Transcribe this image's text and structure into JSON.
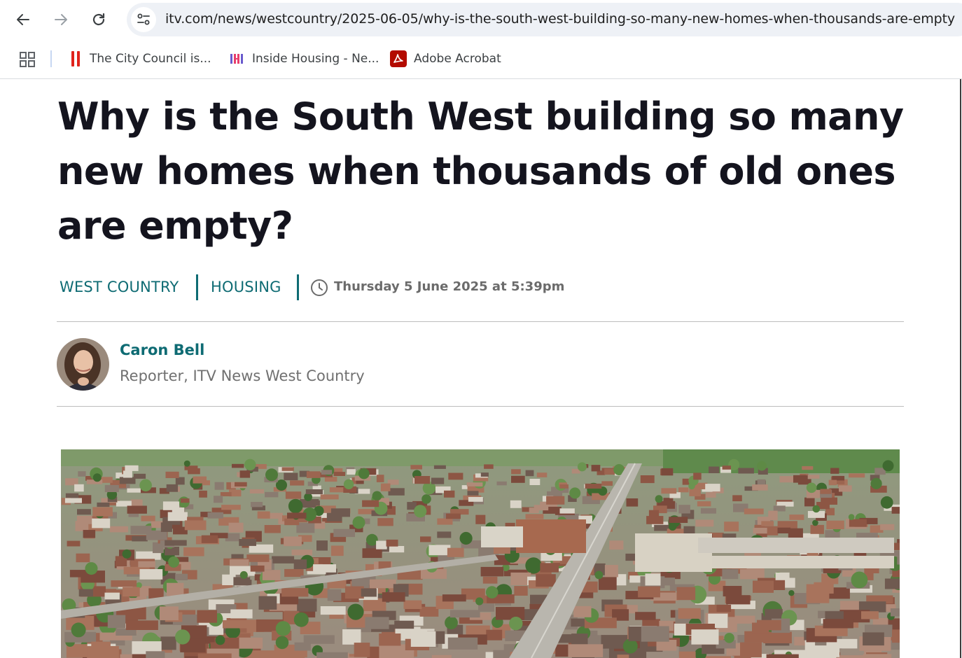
{
  "browser": {
    "url": "itv.com/news/westcountry/2025-06-05/why-is-the-south-west-building-so-many-new-homes-when-thousands-are-empty",
    "icons": {
      "back": "back-arrow-icon",
      "forward": "forward-arrow-icon",
      "reload": "reload-icon",
      "site_info": "tune-icon"
    }
  },
  "bookmarks": {
    "apps_icon": "apps-grid-icon",
    "items": [
      {
        "label": "The City Council is...",
        "icon": "red-bars-icon"
      },
      {
        "label": "Inside Housing - Ne...",
        "icon": "inside-housing-logo-icon"
      },
      {
        "label": "Adobe Acrobat",
        "icon": "acrobat-icon"
      }
    ]
  },
  "article": {
    "headline": "Why is the South West building so many new homes when thousands of old ones are empty?",
    "tags": [
      "WEST COUNTRY",
      "HOUSING"
    ],
    "published": "Thursday 5 June 2025 at 5:39pm",
    "author": {
      "name": "Caron Bell",
      "role": "Reporter, ITV News West Country"
    }
  },
  "theme": {
    "accent": "#0e6b73",
    "headline_color": "#14141e",
    "muted": "#6b6b6b"
  }
}
